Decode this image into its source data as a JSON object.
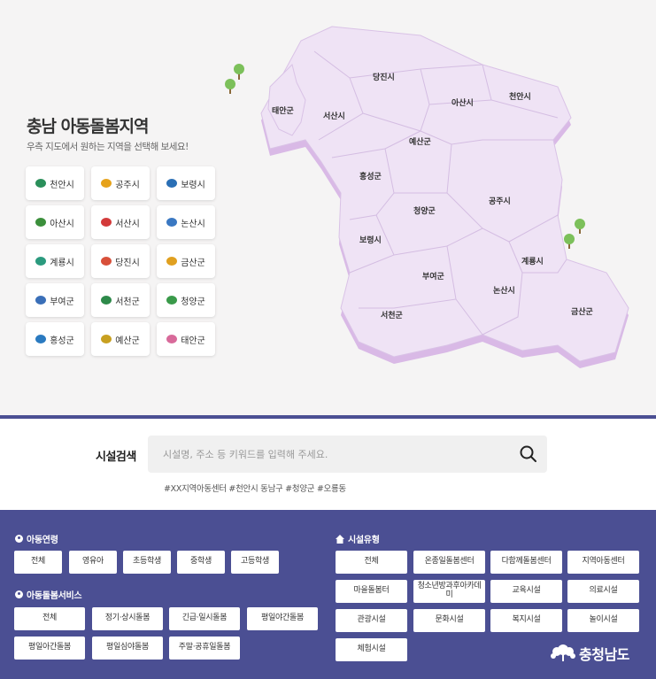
{
  "header": {
    "title": "충남 아동돌봄지역",
    "subtitle": "우측 지도에서 원하는 지역을 선택해 보세요!"
  },
  "cities": [
    {
      "label": "천안시",
      "color": "#2a8f5a"
    },
    {
      "label": "공주시",
      "color": "#e6a21a"
    },
    {
      "label": "보령시",
      "color": "#2a6fb5"
    },
    {
      "label": "아산시",
      "color": "#3b8f3b"
    },
    {
      "label": "서산시",
      "color": "#d33a3a"
    },
    {
      "label": "논산시",
      "color": "#3a78c2"
    },
    {
      "label": "계룡시",
      "color": "#2b9a7e"
    },
    {
      "label": "당진시",
      "color": "#d8503a"
    },
    {
      "label": "금산군",
      "color": "#e0a020"
    },
    {
      "label": "부여군",
      "color": "#3a6fb8"
    },
    {
      "label": "서천군",
      "color": "#2e8a4a"
    },
    {
      "label": "청양군",
      "color": "#3a9a4a"
    },
    {
      "label": "홍성군",
      "color": "#2a7ac0"
    },
    {
      "label": "예산군",
      "color": "#c8a020"
    },
    {
      "label": "태안군",
      "color": "#d86a9a"
    }
  ],
  "map": {
    "regions": [
      "당진시",
      "태안군",
      "서산시",
      "아산시",
      "천안시",
      "예산군",
      "홍성군",
      "공주시",
      "청양군",
      "보령시",
      "계룡시",
      "부여군",
      "논산시",
      "서천군",
      "금산군"
    ],
    "fill": "#efe3f5",
    "shadow": "#d9b9e6"
  },
  "search": {
    "label": "시설검색",
    "placeholder": "시설명, 주소 등 키워드를 입력해 주세요.",
    "tags": "#XX지역아동센터 #천안시 동남구 #청양군 #오룡동"
  },
  "filters": {
    "age_title": "아동연령",
    "age_options": [
      "전체",
      "영유아",
      "초등학생",
      "중학생",
      "고등학생"
    ],
    "service_title": "아동돌봄서비스",
    "service_options": [
      "전체",
      "정기·상시돌봄",
      "긴급·일시돌봄",
      "평일야간돌봄",
      "평일아간돌봄",
      "평일심야돌봄",
      "주말·공휴일돌봄"
    ],
    "facility_title": "시설유형",
    "facility_options": [
      "전체",
      "온종일돌봄센터",
      "다함께돌봄센터",
      "지역아동센터",
      "마을돌봄터",
      "청소년방과후아카데미",
      "교육시설",
      "의료시설",
      "관광시설",
      "문화시설",
      "복지시설",
      "놀이시설",
      "체험시설"
    ]
  },
  "brand": {
    "logo_text": "충청남도"
  },
  "colors": {
    "accent": "#4b4f93",
    "map_fill": "#efe3f5"
  }
}
